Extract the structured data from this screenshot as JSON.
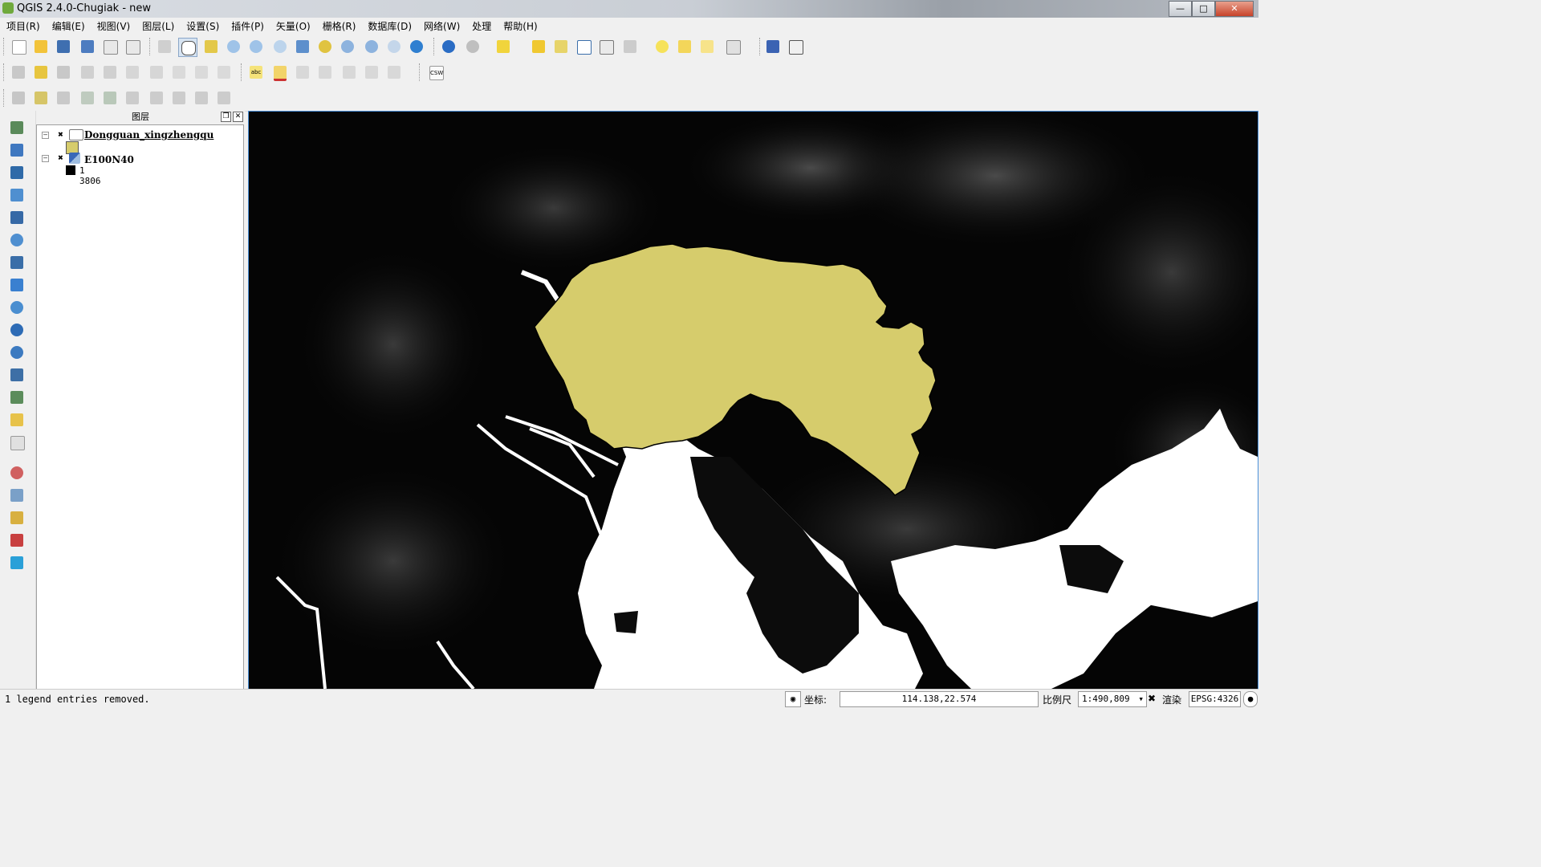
{
  "window": {
    "title": "QGIS 2.4.0-Chugiak - new"
  },
  "menus": [
    "项目(R)",
    "编辑(E)",
    "视图(V)",
    "图层(L)",
    "设置(S)",
    "插件(P)",
    "矢量(O)",
    "栅格(R)",
    "数据库(D)",
    "网络(W)",
    "处理",
    "帮助(H)"
  ],
  "toolbar": {
    "csw_label": "CSW",
    "label_tool": "abc"
  },
  "layers_panel": {
    "title": "图层",
    "layers": [
      {
        "name": "Dongguan_xingzhengqu",
        "type": "vector",
        "visible": true,
        "swatch": "#d6cc6c"
      },
      {
        "name": "E100N40",
        "type": "raster",
        "visible": true,
        "min_label": "1",
        "max_label": "3806"
      }
    ]
  },
  "colors": {
    "polygon_fill": "#d6cc6c",
    "raster_low": "#000000",
    "raster_high": "#ffffff",
    "map_border": "#4a90d9"
  },
  "statusbar": {
    "message": "1 legend entries removed.",
    "coord_label": "坐标:",
    "coord_value": "114.138,22.574",
    "scale_label": "比例尺",
    "scale_value": "1:490,809",
    "render_label": "渲染",
    "crs": "EPSG:4326"
  }
}
